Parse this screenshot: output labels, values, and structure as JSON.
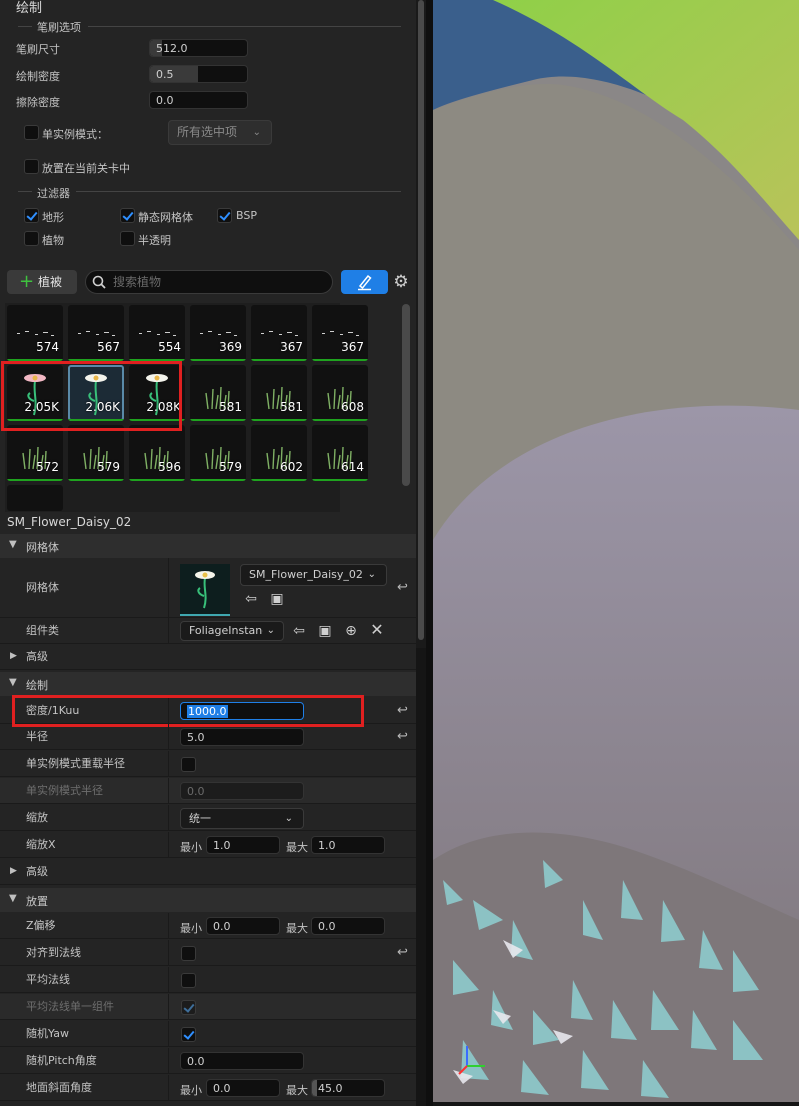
{
  "paint": {
    "title": "绘制",
    "brush_section": "笔刷选项",
    "brush_size_label": "笔刷尺寸",
    "brush_size_value": "512.0",
    "paint_density_label": "绘制密度",
    "paint_density_value": "0.5",
    "erase_density_label": "擦除密度",
    "erase_density_value": "0.0",
    "single_instance_label": "单实例模式：",
    "single_instance_dropdown": "所有选中项",
    "place_in_level_label": "放置在当前关卡中",
    "filter_section": "过滤器",
    "filters": [
      {
        "label": "地形",
        "checked": true
      },
      {
        "label": "静态网格体",
        "checked": true
      },
      {
        "label": "BSP",
        "checked": true
      },
      {
        "label": "植物",
        "checked": false
      },
      {
        "label": "半透明",
        "checked": false
      }
    ]
  },
  "toolbar": {
    "add_foliage_label": "植被",
    "search_placeholder": "搜索植物",
    "icons": [
      "plus-icon",
      "search-icon",
      "paint-brush-icon",
      "settings-gear-icon"
    ]
  },
  "palette": {
    "tiles": [
      {
        "count": "574",
        "kind": "scatter"
      },
      {
        "count": "567",
        "kind": "scatter"
      },
      {
        "count": "554",
        "kind": "scatter"
      },
      {
        "count": "369",
        "kind": "scatter"
      },
      {
        "count": "367",
        "kind": "scatter"
      },
      {
        "count": "367",
        "kind": "scatter"
      },
      {
        "count": "2.05K",
        "kind": "flower-pink"
      },
      {
        "count": "2.06K",
        "kind": "flower-white"
      },
      {
        "count": "2.08K",
        "kind": "flower-white"
      },
      {
        "count": "581",
        "kind": "grass"
      },
      {
        "count": "581",
        "kind": "grass"
      },
      {
        "count": "608",
        "kind": "grass"
      },
      {
        "count": "572",
        "kind": "grass"
      },
      {
        "count": "579",
        "kind": "grass"
      },
      {
        "count": "596",
        "kind": "grass"
      },
      {
        "count": "579",
        "kind": "grass"
      },
      {
        "count": "602",
        "kind": "grass"
      },
      {
        "count": "614",
        "kind": "grass"
      }
    ]
  },
  "details": {
    "asset_name": "SM_Flower_Daisy_02",
    "mesh_category": "网格体",
    "mesh_label": "网格体",
    "mesh_value": "SM_Flower_Daisy_02",
    "component_class_label": "组件类",
    "component_class_value": "FoliageInstanc",
    "advanced_label": "高级",
    "paint_category": "绘制",
    "density_label": "密度/1Kuu",
    "density_value": "1000.0",
    "radius_label": "半径",
    "radius_value": "5.0",
    "single_override_radius_label": "单实例模式重载半径",
    "single_radius_label": "单实例模式半径",
    "single_radius_value": "0.0",
    "scaling_label": "缩放",
    "scaling_value": "统一",
    "scale_x_label": "缩放X",
    "min_label": "最小",
    "max_label": "最大",
    "scale_x_min": "1.0",
    "scale_x_max": "1.0",
    "advanced2_label": "高级",
    "placement_category": "放置",
    "z_offset_label": "Z偏移",
    "z_offset_min": "0.0",
    "z_offset_max": "0.0",
    "align_normal_label": "对齐到法线",
    "average_normal_label": "平均法线",
    "average_normal_single_label": "平均法线单一组件",
    "random_yaw_label": "随机Yaw",
    "random_pitch_label": "随机Pitch角度",
    "random_pitch_value": "0.0",
    "ground_slope_label": "地面斜面角度",
    "ground_slope_min": "0.0",
    "ground_slope_max": "45.0"
  },
  "colors": {
    "accent_blue": "#1f7fe6",
    "highlight_red": "#e02020",
    "count_bar_green": "#1fa31f"
  }
}
